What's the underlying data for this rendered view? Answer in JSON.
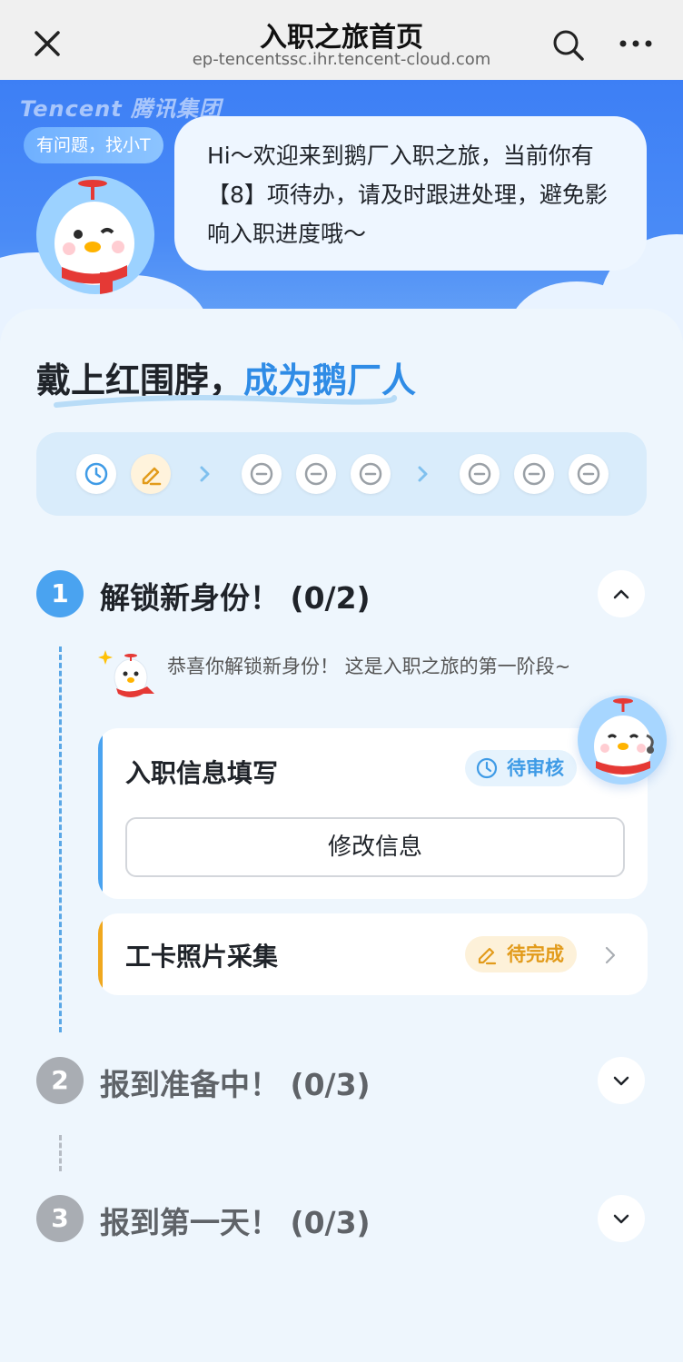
{
  "nav": {
    "title": "入职之旅首页",
    "url": "ep-tencentssc.ihr.tencent-cloud.com"
  },
  "banner": {
    "brand": "Tencent 腾讯集团",
    "help_label": "有问题，找小T",
    "greeting": "Hi～欢迎来到鹅厂入职之旅，当前你有【8】项待办，请及时跟进处理，避免影响入职进度哦～"
  },
  "slogan": {
    "part1": "戴上红围脖，",
    "part2": "成为鹅厂人"
  },
  "progress_steps": [
    "clock-icon",
    "pencil-icon",
    "arrow-icon",
    "minus-circle-icon",
    "minus-circle-icon",
    "minus-circle-icon",
    "arrow-icon",
    "minus-circle-icon",
    "minus-circle-icon",
    "minus-circle-icon"
  ],
  "stages": [
    {
      "number": "1",
      "title": "解锁新身份！ (0/2)",
      "expanded": true,
      "intro": "恭喜你解锁新身份！ 这是入职之旅的第一阶段~",
      "tasks": [
        {
          "title": "入职信息填写",
          "status": "待审核",
          "action": "修改信息"
        },
        {
          "title": "工卡照片采集",
          "status": "待完成"
        }
      ]
    },
    {
      "number": "2",
      "title": "报到准备中！ (0/3)",
      "expanded": false
    },
    {
      "number": "3",
      "title": "报到第一天！ (0/3)",
      "expanded": false
    }
  ],
  "colors": {
    "primary_blue": "#3d7ff5",
    "active_stage": "#4aa3f0",
    "inactive_stage": "#a9adb3",
    "review_badge_bg": "#e6f3fd",
    "review_badge_text": "#3f9be6",
    "pending_badge_bg": "#fdf1d9",
    "pending_badge_text": "#e29b1b"
  }
}
